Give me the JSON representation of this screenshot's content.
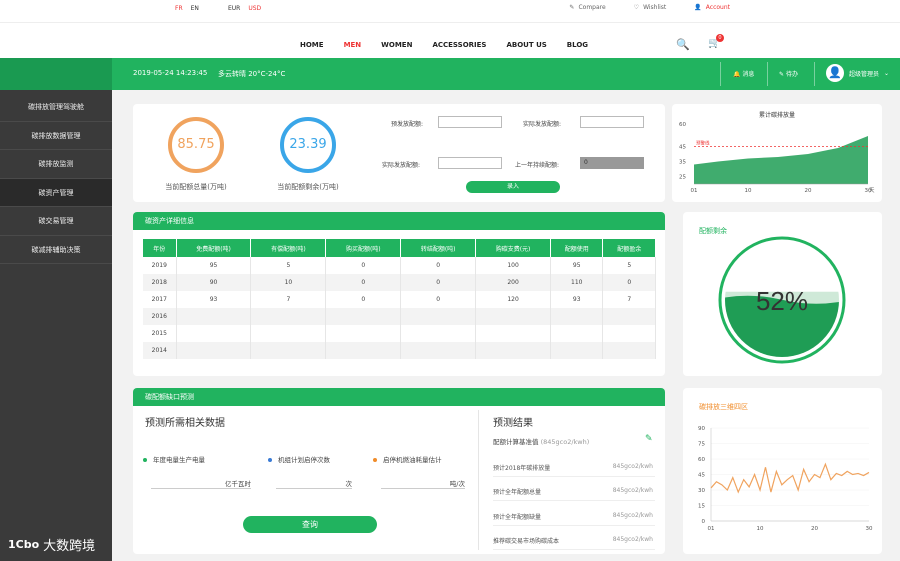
{
  "topbar": {
    "languages": [
      "FR",
      "EN"
    ],
    "currencies": [
      "EUR",
      "USD"
    ],
    "compare": "Compare",
    "wishlist": "Wishlist",
    "account": "Account"
  },
  "nav": {
    "links": [
      "HOME",
      "MEN",
      "WOMEN",
      "ACCESSORIES",
      "ABOUT US",
      "BLOG"
    ],
    "cart_count": "0"
  },
  "header": {
    "datetime": "2019-05-24 14:23:45",
    "weather": "多云转晴 20°C-24°C",
    "messages": "消息",
    "tasks": "待办",
    "user": "超级管理员"
  },
  "sidebar": {
    "items": [
      "碳排放管理驾驶舱",
      "碳排放数据管理",
      "碳排放监测",
      "碳资产管理",
      "碳交易管理",
      "碳减排辅助决策"
    ]
  },
  "metrics": {
    "total_value": "85.75",
    "total_label": "当前配额总量(万吨)",
    "remain_value": "23.39",
    "remain_label": "当前配额剩余(万吨)",
    "f1_label": "预发放配额:",
    "f2_label": "实际发放配额:",
    "f3_label": "实际发放配额:",
    "f4_label": "上一年持续配额:",
    "f4_value": "0",
    "submit": "录入"
  },
  "chart_data": [
    {
      "type": "area",
      "title": "累计碳排放量",
      "x": [
        1,
        5,
        10,
        15,
        20,
        25,
        30
      ],
      "y": [
        33,
        35,
        37,
        38,
        40,
        44,
        52
      ],
      "xticks": [
        "01",
        "10",
        "20",
        "30"
      ],
      "yticks": [
        25,
        35,
        45,
        60
      ],
      "ylim": [
        20,
        60
      ],
      "xunit": "天",
      "threshold_label": "预警线",
      "threshold": 45,
      "color": "#1f9d55"
    },
    {
      "type": "line",
      "title": "碳排放三维四区",
      "x": [
        1,
        2,
        3,
        4,
        5,
        6,
        7,
        8,
        9,
        10,
        11,
        12,
        13,
        14,
        15,
        16,
        17,
        18,
        19,
        20,
        21,
        22,
        23,
        24,
        25,
        26,
        27,
        28,
        29,
        30
      ],
      "y": [
        32,
        38,
        35,
        30,
        42,
        28,
        40,
        33,
        45,
        30,
        52,
        28,
        48,
        35,
        40,
        44,
        30,
        50,
        38,
        45,
        42,
        55,
        40,
        46,
        44,
        48,
        45,
        46,
        44,
        47
      ],
      "xticks": [
        "01",
        "10",
        "20",
        "30"
      ],
      "yticks": [
        0,
        15,
        30,
        45,
        60,
        75,
        90
      ],
      "ylim": [
        0,
        90
      ],
      "color": "#f0a35e"
    }
  ],
  "quota_remaining": {
    "title": "配额剩余",
    "percent": 52,
    "label": "52%"
  },
  "details": {
    "title": "碳资产详细信息",
    "columns": [
      "年份",
      "免费配额(吨)",
      "有偿配额(吨)",
      "购买配额(吨)",
      "转结配额(吨)",
      "购碳支费(元)",
      "配额使用",
      "配额盈余"
    ],
    "rows": [
      [
        "2019",
        "95",
        "5",
        "0",
        "0",
        "100",
        "95",
        "5"
      ],
      [
        "2018",
        "90",
        "10",
        "0",
        "0",
        "200",
        "110",
        "0"
      ],
      [
        "2017",
        "93",
        "7",
        "0",
        "0",
        "120",
        "93",
        "7"
      ],
      [
        "2016",
        "",
        "",
        "",
        "",
        "",
        "",
        ""
      ],
      [
        "2015",
        "",
        "",
        "",
        "",
        "",
        "",
        ""
      ],
      [
        "2014",
        "",
        "",
        "",
        "",
        "",
        "",
        ""
      ]
    ]
  },
  "forecast": {
    "title": "碳配额缺口预测",
    "left_title": "预测所需相关数据",
    "items": [
      {
        "label": "年度电量生产电量",
        "unit": "亿千瓦时",
        "color": "#21b35f"
      },
      {
        "label": "机组计划启停次数",
        "unit": "次",
        "color": "#3a7bd5"
      },
      {
        "label": "启停机燃油耗量估计",
        "unit": "吨/次",
        "color": "#f08c2a"
      }
    ],
    "query": "查询",
    "right_title": "预测结果",
    "baseline_label": "配额计算基准值",
    "baseline_value": "(845gco2/kwh)",
    "results": [
      {
        "label": "预计2018年碳排放量",
        "value": "845gco2/kwh"
      },
      {
        "label": "预计全年配额总量",
        "value": "845gco2/kwh"
      },
      {
        "label": "预计全年配额缺量",
        "value": "845gco2/kwh"
      },
      {
        "label": "推荐碳交易市场购碳成本",
        "value": "845gco2/kwh"
      }
    ]
  },
  "watermark": {
    "logo": "1Cbo",
    "text": "大数跨境"
  }
}
